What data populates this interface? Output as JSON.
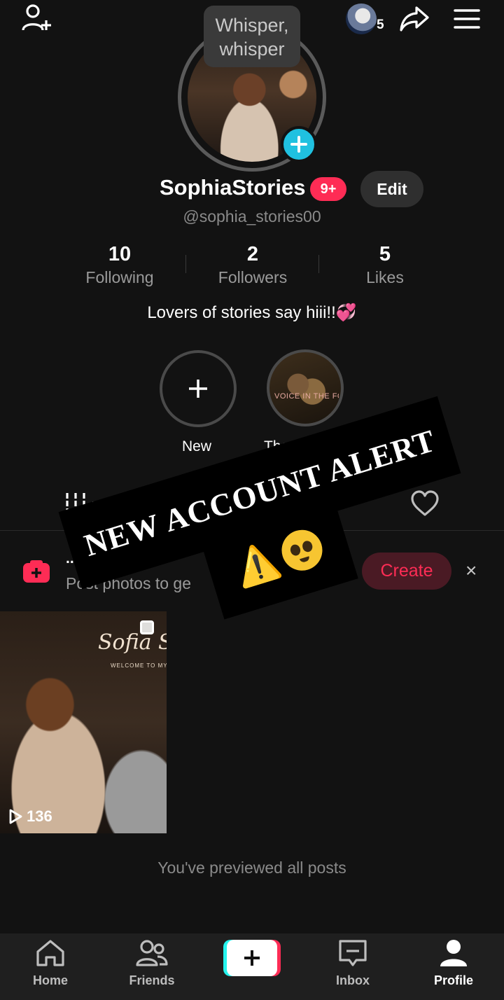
{
  "header": {
    "add_friend_icon": "person-plus-icon",
    "tooltip": "Whisper, whisper",
    "viewers_count": "5",
    "share_icon": "share-arrow-icon",
    "menu_icon": "hamburger-menu-icon"
  },
  "profile": {
    "display_name": "SophiaStories",
    "notification_badge": "9+",
    "edit_label": "Edit",
    "handle": "@sophia_stories00",
    "bio": "Lovers of stories say hiii!!💞"
  },
  "stats": [
    {
      "value": "10",
      "label": "Following"
    },
    {
      "value": "2",
      "label": "Followers"
    },
    {
      "value": "5",
      "label": "Likes"
    }
  ],
  "highlights": {
    "new_label": "New",
    "story_label": "The F",
    "story_cover_text": "VOICE IN THE FO"
  },
  "overlay": {
    "alert_text": "NEW ACCOUNT ALERT",
    "emoji_warning": "⚠️"
  },
  "banner": {
    "title": "...n cha",
    "subtitle": "Post photos to ge",
    "create_label": "Create",
    "close_label": "×"
  },
  "post": {
    "sign_text": "Sofia Sto",
    "welcome_text": "WELCOME TO MY WO",
    "views": "136"
  },
  "footer_text": "You've previewed all posts",
  "nav": {
    "home": "Home",
    "friends": "Friends",
    "inbox": "Inbox",
    "profile": "Profile"
  },
  "colors": {
    "background": "#121212",
    "accent_red": "#fe2c55",
    "accent_cyan": "#25f4ee",
    "avatar_plus": "#20c1e0"
  }
}
